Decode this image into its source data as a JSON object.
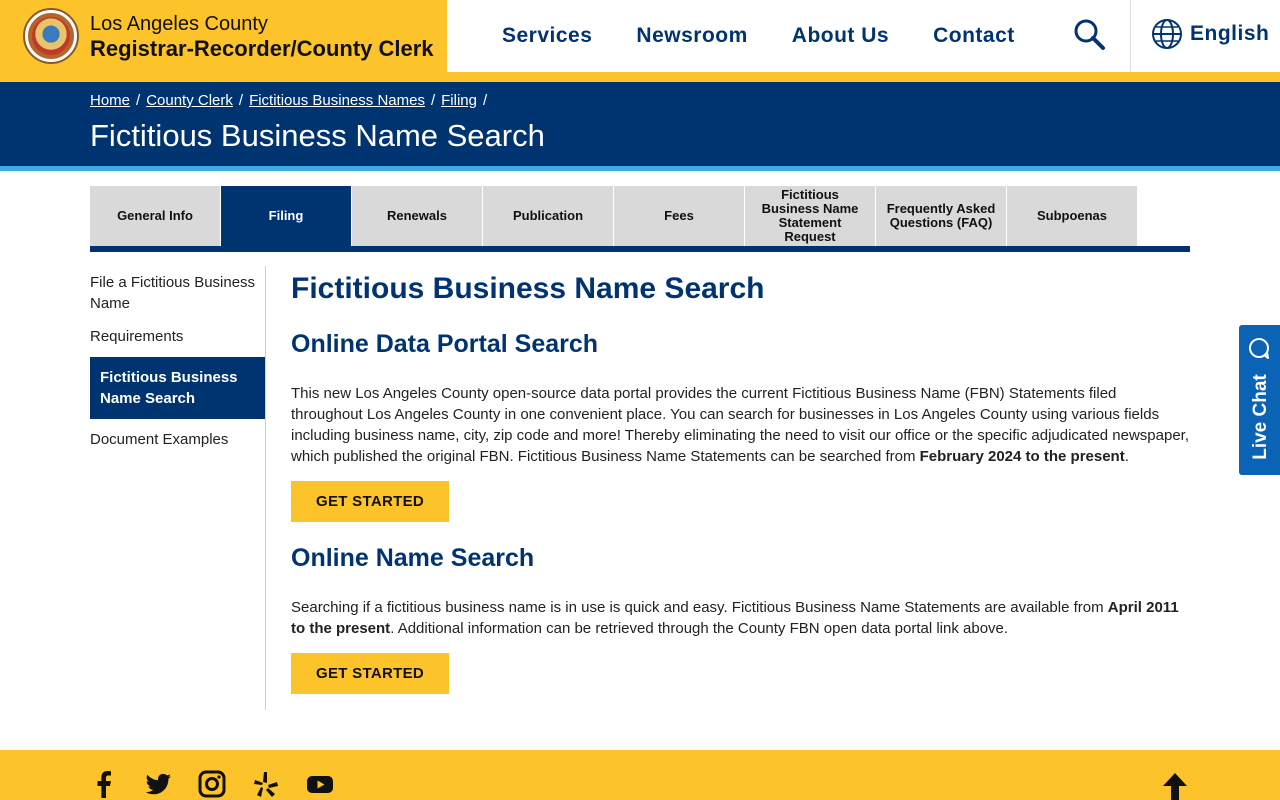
{
  "header": {
    "org_line1": "Los Angeles County",
    "org_line2": "Registrar-Recorder/County Clerk",
    "nav": [
      "Services",
      "Newsroom",
      "About Us",
      "Contact"
    ],
    "language": "English"
  },
  "breadcrumb": [
    "Home",
    "County Clerk",
    "Fictitious Business Names",
    "Filing"
  ],
  "page_title": "Fictitious Business Name Search",
  "tabs": [
    {
      "label": "General Info"
    },
    {
      "label": "Filing"
    },
    {
      "label": "Renewals"
    },
    {
      "label": "Publication"
    },
    {
      "label": "Fees"
    },
    {
      "label": "Fictitious Business Name Statement Request"
    },
    {
      "label": "Frequently Asked Questions (FAQ)"
    },
    {
      "label": "Subpoenas"
    }
  ],
  "active_tab": "Filing",
  "sidenav": [
    {
      "label": "File a Fictitious Business Name"
    },
    {
      "label": "Requirements"
    },
    {
      "label": "Fictitious Business Name Search"
    },
    {
      "label": "Document Examples"
    }
  ],
  "main": {
    "heading": "Fictitious Business Name Search",
    "section1": {
      "title": "Online Data Portal Search",
      "text_before": "This new Los Angeles County open-source data portal provides the current Fictitious Business Name (FBN) Statements filed throughout Los Angeles County in one convenient place. You can search for businesses in Los Angeles County using various fields including business name, city, zip code and more! Thereby eliminating the need to visit our office or the specific adjudicated newspaper, which published the original FBN. Fictitious Business Name Statements can be searched from ",
      "text_bold": "February 2024 to the present",
      "text_after": ".",
      "button": "GET STARTED"
    },
    "section2": {
      "title": "Online Name Search",
      "text_before": "Searching if a fictitious business name is in use is quick and easy. Fictitious Business Name Statements are available from ",
      "text_bold": "April 2011 to the present",
      "text_after": ". Additional information can be retrieved through the County FBN open data portal link above.",
      "button": "GET STARTED"
    }
  },
  "live_chat": "Live Chat",
  "footer": {
    "social": [
      "facebook-icon",
      "twitter-icon",
      "instagram-icon",
      "yelp-icon",
      "youtube-icon"
    ]
  },
  "colors": {
    "gold": "#fdc32a",
    "navy": "#003471",
    "sky": "#3fa9e5",
    "chat_blue": "#0a63b5",
    "tab_gray": "#d9d9d9"
  }
}
